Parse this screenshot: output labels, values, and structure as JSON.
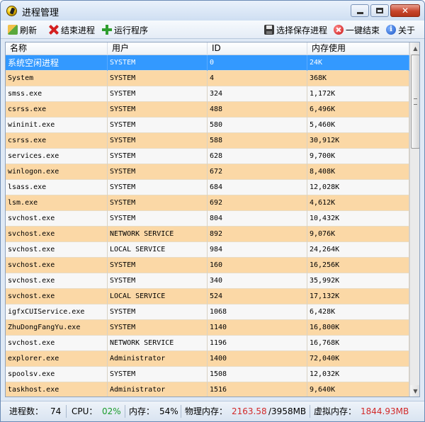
{
  "window": {
    "title": "进程管理"
  },
  "toolbar": {
    "refresh": "刷新",
    "end_process": "结束进程",
    "run_program": "运行程序",
    "save_processes": "选择保存进程",
    "one_key_end": "一键结束",
    "about": "关于"
  },
  "columns": [
    "名称",
    "用户",
    "ID",
    "内存使用"
  ],
  "rows": [
    [
      "系统空闲进程",
      "SYSTEM",
      "0",
      "24K"
    ],
    [
      "System",
      "SYSTEM",
      "4",
      "368K"
    ],
    [
      "smss.exe",
      "SYSTEM",
      "324",
      "1,172K"
    ],
    [
      "csrss.exe",
      "SYSTEM",
      "488",
      "6,496K"
    ],
    [
      "wininit.exe",
      "SYSTEM",
      "580",
      "5,460K"
    ],
    [
      "csrss.exe",
      "SYSTEM",
      "588",
      "30,912K"
    ],
    [
      "services.exe",
      "SYSTEM",
      "628",
      "9,700K"
    ],
    [
      "winlogon.exe",
      "SYSTEM",
      "672",
      "8,408K"
    ],
    [
      "lsass.exe",
      "SYSTEM",
      "684",
      "12,028K"
    ],
    [
      "lsm.exe",
      "SYSTEM",
      "692",
      "4,612K"
    ],
    [
      "svchost.exe",
      "SYSTEM",
      "804",
      "10,432K"
    ],
    [
      "svchost.exe",
      "NETWORK SERVICE",
      "892",
      "9,076K"
    ],
    [
      "svchost.exe",
      "LOCAL SERVICE",
      "984",
      "24,264K"
    ],
    [
      "svchost.exe",
      "SYSTEM",
      "160",
      "16,256K"
    ],
    [
      "svchost.exe",
      "SYSTEM",
      "340",
      "35,992K"
    ],
    [
      "svchost.exe",
      "LOCAL SERVICE",
      "524",
      "17,132K"
    ],
    [
      "igfxCUIService.exe",
      "SYSTEM",
      "1068",
      "6,428K"
    ],
    [
      "ZhuDongFangYu.exe",
      "SYSTEM",
      "1140",
      "16,800K"
    ],
    [
      "svchost.exe",
      "NETWORK SERVICE",
      "1196",
      "16,768K"
    ],
    [
      "explorer.exe",
      "Administrator",
      "1400",
      "72,040K"
    ],
    [
      "spoolsv.exe",
      "SYSTEM",
      "1508",
      "12,032K"
    ],
    [
      "taskhost.exe",
      "Administrator",
      "1516",
      "9,640K"
    ]
  ],
  "status": {
    "process_count_label": "进程数：",
    "process_count": "74",
    "cpu_label": "CPU：",
    "cpu": "02%",
    "memory_label": "内存：",
    "memory": "54%",
    "physical_label": "物理内存：",
    "physical_used": "2163.58",
    "physical_total": "/3958MB",
    "virtual_label": "虚拟内存：",
    "virtual": "1844.93MB"
  }
}
